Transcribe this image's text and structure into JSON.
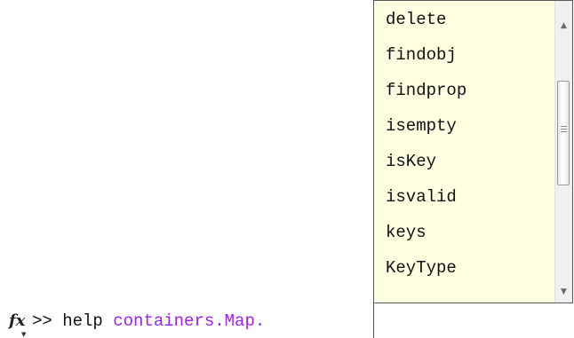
{
  "command_line": {
    "fx_icon": "fx-icon",
    "prompt": ">> ",
    "command": "help ",
    "argument": "containers.Map."
  },
  "autocomplete": {
    "items": [
      "delete",
      "findobj",
      "findprop",
      "isempty",
      "isKey",
      "isvalid",
      "keys",
      "KeyType"
    ],
    "scroll_up_icon": "scroll-up-arrow-icon",
    "scroll_down_icon": "scroll-down-arrow-icon",
    "colors": {
      "popup_background": "#ffffe1",
      "argument_text": "#a020f0"
    }
  }
}
